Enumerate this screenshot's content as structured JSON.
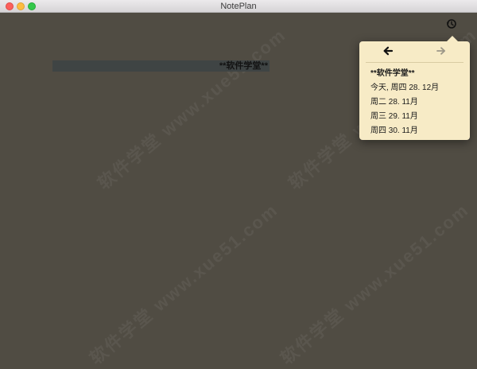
{
  "window": {
    "title": "NotePlan"
  },
  "toolbar": {
    "history_icon": "history-clock-icon"
  },
  "editor": {
    "lines": [
      {
        "text": "**软件学堂**"
      }
    ]
  },
  "history_popover": {
    "back_icon": "arrow-left-icon",
    "forward_icon": "arrow-right-icon",
    "items": [
      {
        "label": "**软件学堂**",
        "current": true
      },
      {
        "label": "今天, 周四 28. 12月",
        "current": false
      },
      {
        "label": "周二 28. 11月",
        "current": false
      },
      {
        "label": "周三 29. 11月",
        "current": false
      },
      {
        "label": "周四 30. 11月",
        "current": false
      }
    ]
  },
  "watermark": {
    "text": "软件学堂 www.xue51.com"
  },
  "colors": {
    "background": "#504c43",
    "popover": "#f7ebc6",
    "line_highlight": "#3f4444"
  }
}
